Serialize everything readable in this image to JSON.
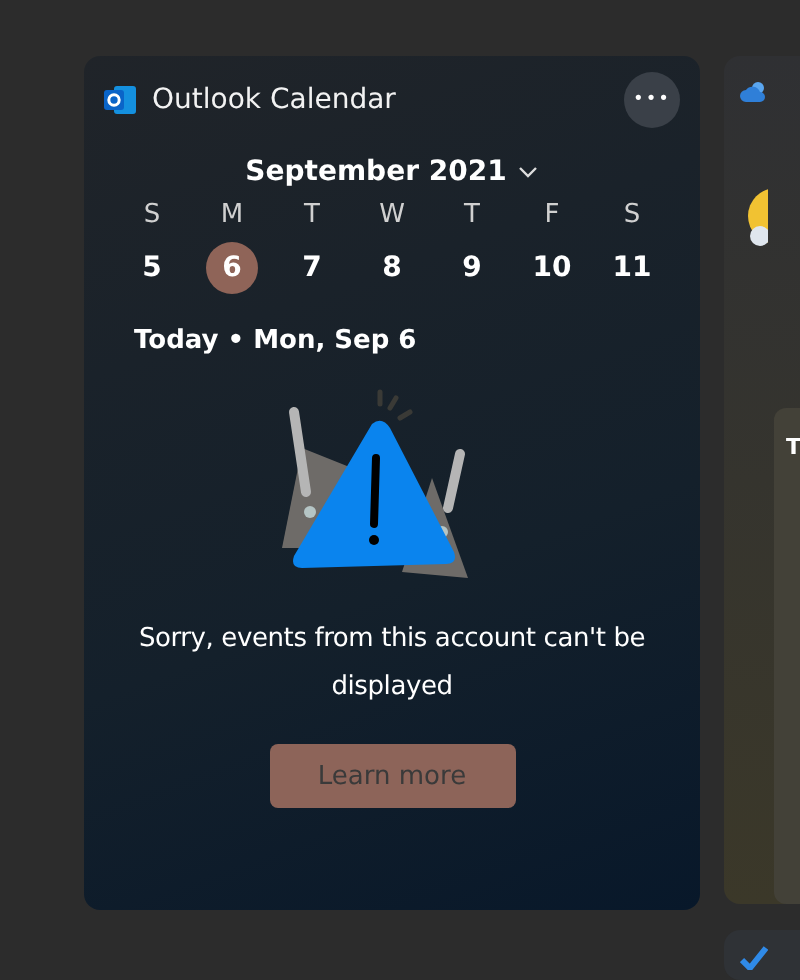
{
  "calendar_widget": {
    "title": "Outlook Calendar",
    "more_button": "•••",
    "month": "September 2021",
    "weekdays": [
      "S",
      "M",
      "T",
      "W",
      "T",
      "F",
      "S"
    ],
    "days": [
      {
        "label": "5",
        "selected": false
      },
      {
        "label": "6",
        "selected": true
      },
      {
        "label": "7",
        "selected": false
      },
      {
        "label": "8",
        "selected": false
      },
      {
        "label": "9",
        "selected": false
      },
      {
        "label": "10",
        "selected": false
      },
      {
        "label": "11",
        "selected": false
      }
    ],
    "agenda_heading": "Today • Mon, Sep 6",
    "message": "Sorry, events from this account can't be displayed",
    "button": "Learn more"
  },
  "weather_widget": {
    "panel_text": "T"
  }
}
